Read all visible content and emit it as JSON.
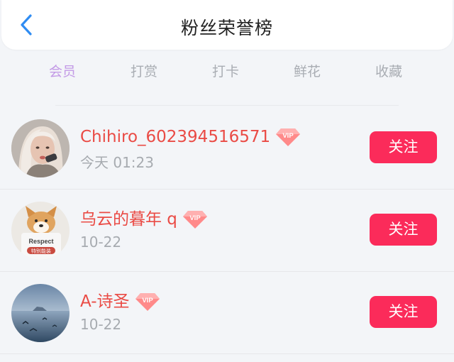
{
  "header": {
    "title": "粉丝荣誉榜",
    "back_icon": "chevron-left-icon"
  },
  "tabs": [
    {
      "label": "会员",
      "active": true
    },
    {
      "label": "打赏",
      "active": false
    },
    {
      "label": "打卡",
      "active": false
    },
    {
      "label": "鲜花",
      "active": false
    },
    {
      "label": "收藏",
      "active": false
    }
  ],
  "fans": [
    {
      "name": "Chihiro_602394516571",
      "time": "今天 01:23",
      "badge": "VIP",
      "button": "关注"
    },
    {
      "name": "乌云的暮年 q",
      "time": "10-22",
      "badge": "VIP",
      "button": "关注"
    },
    {
      "name": "A-诗圣",
      "time": "10-22",
      "badge": "VIP",
      "button": "关注"
    }
  ],
  "avatar2_text": {
    "top": "Respect",
    "bottom": "特别能装"
  },
  "colors": {
    "accent_tab": "#c39ae6",
    "username": "#ea4b45",
    "follow_button": "#fb2b5a",
    "back_arrow": "#2f8cf2"
  }
}
